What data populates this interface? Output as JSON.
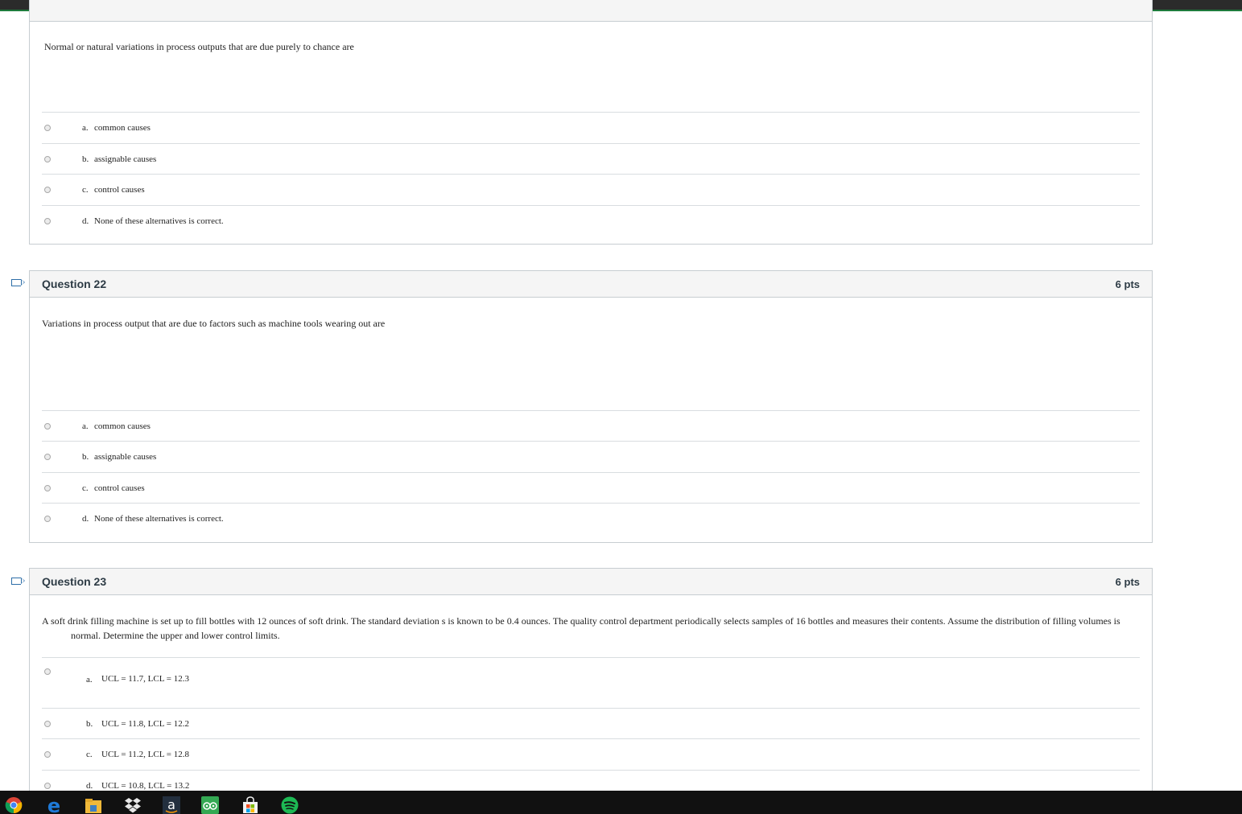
{
  "q21": {
    "text": "Normal or natural variations in process outputs that are due purely to chance are",
    "answers": [
      {
        "letter": "a.",
        "text": "common causes"
      },
      {
        "letter": "b.",
        "text": "assignable causes"
      },
      {
        "letter": "c.",
        "text": "control causes"
      },
      {
        "letter": "d.",
        "text": "None of these alternatives is correct."
      }
    ]
  },
  "q22": {
    "title": "Question 22",
    "points": "6 pts",
    "text": "Variations in process output that are due to factors such as machine tools wearing out are",
    "answers": [
      {
        "letter": "a.",
        "text": "common causes"
      },
      {
        "letter": "b.",
        "text": "assignable causes"
      },
      {
        "letter": "c.",
        "text": "control causes"
      },
      {
        "letter": "d.",
        "text": "None of these alternatives is correct."
      }
    ]
  },
  "q23": {
    "title": "Question 23",
    "points": "6 pts",
    "text_line1": "A soft drink filling machine is set up to fill bottles with 12 ounces of soft drink.  The standard deviation s is known to be 0.4 ounces.  The quality control department periodically selects samples of 16 bottles and measures their contents.  Assume the distribution of filling volumes is",
    "text_line2": "normal.  Determine the upper and lower control limits.",
    "answers": [
      {
        "letter": "a.",
        "text": "UCL = 11.7, LCL = 12.3"
      },
      {
        "letter": "b.",
        "text": "UCL = 11.8, LCL = 12.2"
      },
      {
        "letter": "c.",
        "text": "UCL = 11.2, LCL = 12.8"
      },
      {
        "letter": "d.",
        "text": "UCL = 10.8, LCL = 13.2"
      }
    ]
  },
  "taskbar": {
    "icons": [
      "chrome-icon",
      "edge-icon",
      "file-explorer-icon",
      "dropbox-icon",
      "amazon-icon",
      "tripadvisor-icon",
      "store-icon",
      "spotify-icon"
    ],
    "amazon_glyph": "a"
  },
  "colors": {
    "accent": "#2d6ea8",
    "header_bg": "#f5f5f5",
    "border": "#c7cdd1",
    "taskbar_bg": "#111111"
  }
}
